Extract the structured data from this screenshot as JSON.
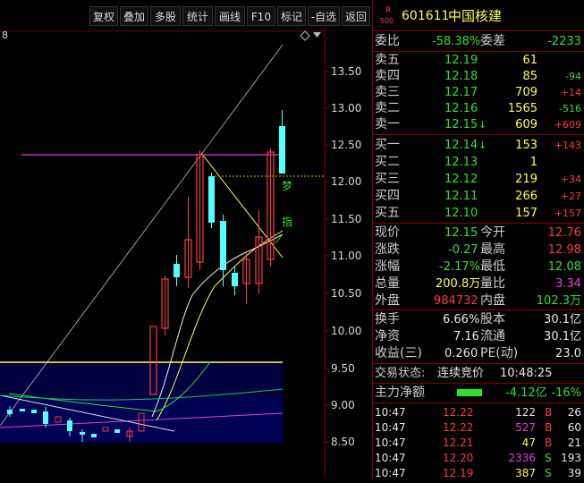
{
  "toolbar": {
    "buttons": [
      "复权",
      "叠加",
      "多股",
      "统计",
      "画线",
      "F10",
      "标记",
      "-自选",
      "返回"
    ]
  },
  "chart": {
    "period_marker": "8",
    "price_axis": [
      "13.50",
      "13.00",
      "12.50",
      "12.00",
      "11.50",
      "11.00",
      "10.50",
      "10.00",
      "9.50",
      "9.00",
      "8.50"
    ],
    "annotation_meng": "梦",
    "annotation_zhi": "指"
  },
  "stock": {
    "r_label": "R",
    "r_sub": "500",
    "code": "601611",
    "name": "中国核建"
  },
  "weibi": {
    "label1": "委比",
    "value1": "-58.38%",
    "label2": "委差",
    "value2": "-2233"
  },
  "asks": [
    {
      "label": "卖五",
      "price": "12.19",
      "vol": "61",
      "chg": ""
    },
    {
      "label": "卖四",
      "price": "12.18",
      "vol": "85",
      "chg": "-94"
    },
    {
      "label": "卖三",
      "price": "12.17",
      "vol": "709",
      "chg": "+14"
    },
    {
      "label": "卖二",
      "price": "12.16",
      "vol": "1565",
      "chg": "-516"
    },
    {
      "label": "卖一",
      "price": "12.15",
      "vol": "609",
      "chg": "+609"
    }
  ],
  "bids": [
    {
      "label": "买一",
      "price": "12.14",
      "vol": "153",
      "chg": "+143"
    },
    {
      "label": "买二",
      "price": "12.13",
      "vol": "1",
      "chg": ""
    },
    {
      "label": "买三",
      "price": "12.12",
      "vol": "219",
      "chg": "+34"
    },
    {
      "label": "买四",
      "price": "12.11",
      "vol": "266",
      "chg": "+27"
    },
    {
      "label": "买五",
      "price": "12.10",
      "vol": "157",
      "chg": "+157"
    }
  ],
  "quote": [
    {
      "l1": "现价",
      "v1": "12.15",
      "l2": "今开",
      "v2": "12.76"
    },
    {
      "l1": "涨跌",
      "v1": "-0.27",
      "l2": "最高",
      "v2": "12.98"
    },
    {
      "l1": "涨幅",
      "v1": "-2.17%",
      "l2": "最低",
      "v2": "12.08"
    },
    {
      "l1": "总量",
      "v1": "200.8万",
      "l2": "量比",
      "v2": "3.34"
    },
    {
      "l1": "外盘",
      "v1": "984732",
      "l2": "内盘",
      "v2": "102.3万"
    }
  ],
  "fundamentals": [
    {
      "l1": "换手",
      "v1": "6.66%",
      "l2": "股本",
      "v2": "30.1亿"
    },
    {
      "l1": "净资",
      "v1": "7.16",
      "l2": "流通",
      "v2": "30.1亿"
    },
    {
      "l1": "收益(三)",
      "v1": "0.260",
      "l2": "PE(动)",
      "v2": "23.0"
    }
  ],
  "status": {
    "label": "交易状态:",
    "value": "连续竞价",
    "time": "10:48:25"
  },
  "flow": {
    "label": "主力净额",
    "value": "-4.12亿",
    "pct": "-16%"
  },
  "ticks": [
    {
      "time": "10:47",
      "price": "12.22",
      "vol": "122",
      "side": "B",
      "num": "26"
    },
    {
      "time": "10:47",
      "price": "12.22",
      "vol": "527",
      "side": "B",
      "num": "60"
    },
    {
      "time": "10:47",
      "price": "12.21",
      "vol": "47",
      "side": "B",
      "num": "21"
    },
    {
      "time": "10:47",
      "price": "12.20",
      "vol": "2336",
      "side": "S",
      "num": "193"
    },
    {
      "time": "10:47",
      "price": "12.19",
      "vol": "387",
      "side": "S",
      "num": "39"
    }
  ],
  "colors": {
    "up": "#ff3b3b",
    "down": "#2fe02f",
    "cyan_candle": "#54ffff",
    "magenta_line": "#e040e0"
  }
}
